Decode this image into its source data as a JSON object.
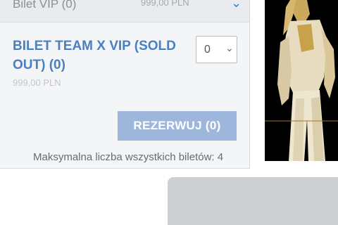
{
  "ticket_prev": {
    "name": "Bilet VIP (0)",
    "price": "999,00 PLN",
    "chevron_icon": "chevron-down-icon"
  },
  "ticket": {
    "name": "BILET TEAM X VIP (SOLD OUT) (0)",
    "price": "999,00 PLN",
    "quantity": "0",
    "quantity_icon": "chevron-down-icon"
  },
  "reserve_button": "REZERWUJ (0)",
  "limit_text": "Maksymalna liczba wszystkich biletów: 4",
  "colors": {
    "accent": "#4a7fc0",
    "button": "#9db7dc",
    "panel": "#f4f5f7"
  }
}
